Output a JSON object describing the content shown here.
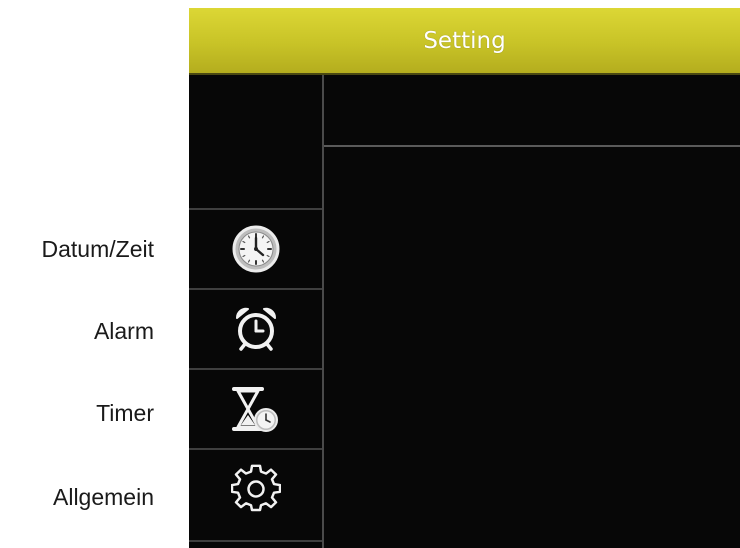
{
  "header": {
    "title": "Setting"
  },
  "menu": [
    {
      "label": "Datum/Zeit",
      "icon": "clock-icon"
    },
    {
      "label": "Alarm",
      "icon": "alarm-clock-icon"
    },
    {
      "label": "Timer",
      "icon": "hourglass-icon"
    },
    {
      "label": "Allgemein",
      "icon": "gear-icon"
    }
  ],
  "colors": {
    "header": "#c8c327",
    "screen": "#070707",
    "divider": "#4a4a4a"
  }
}
